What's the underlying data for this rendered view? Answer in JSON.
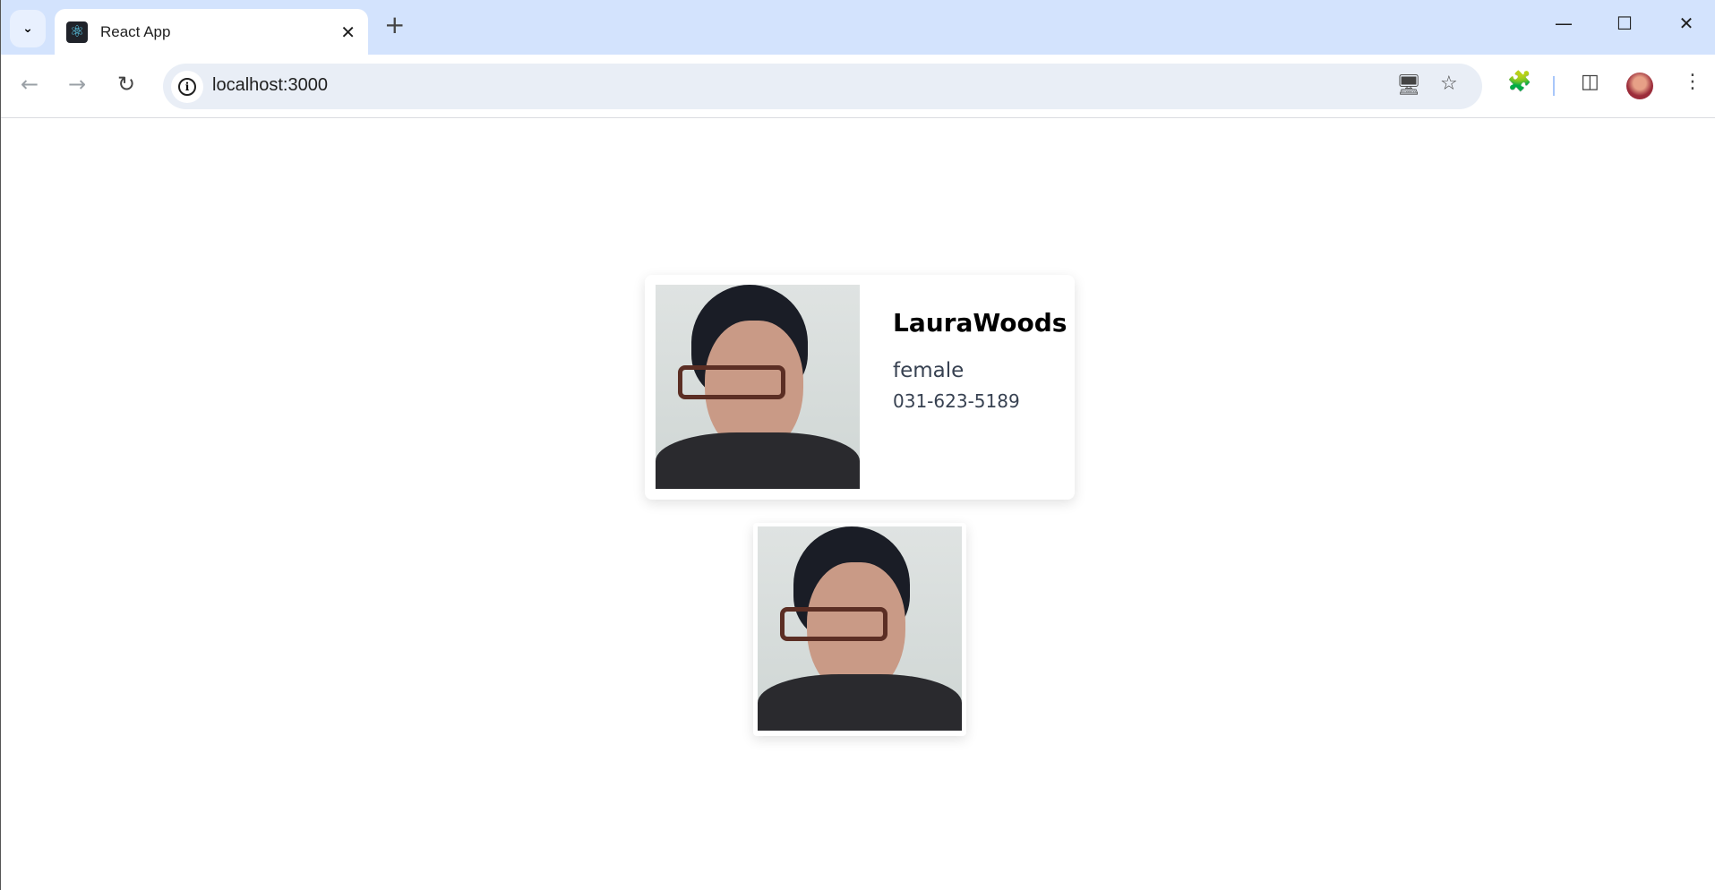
{
  "browser": {
    "tab_title": "React App",
    "url": "localhost:3000",
    "icons": [
      "tab-search-icon",
      "react-favicon",
      "close-icon",
      "new-tab-icon",
      "minimize-icon",
      "maximize-icon",
      "window-close-icon",
      "back-icon",
      "forward-icon",
      "reload-icon",
      "site-info-icon",
      "install-app-icon",
      "bookmark-star-icon",
      "extensions-icon",
      "side-panel-icon",
      "profile-avatar",
      "menu-icon"
    ]
  },
  "profile_card": {
    "name": "LauraWoods",
    "gender": "female",
    "phone": "031-623-5189"
  }
}
